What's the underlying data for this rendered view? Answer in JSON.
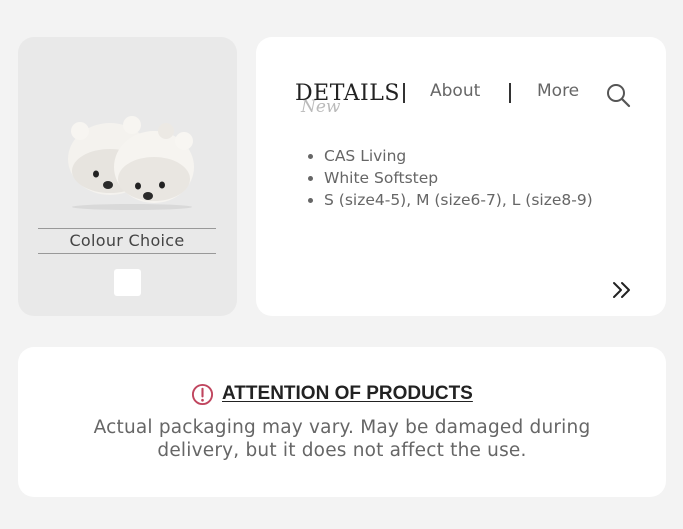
{
  "product": {
    "image_icon": "plush-slippers-image",
    "colour_label": "Colour Choice",
    "swatch_color": "#ffffff"
  },
  "details": {
    "tabs": {
      "details": "DETAILS",
      "details_overlay": "New",
      "about": "About",
      "more": "More"
    },
    "search_icon": "search-icon",
    "specs": [
      "CAS Living",
      "White Softstep",
      "S (size4-5), M (size6-7), L (size8-9)"
    ],
    "next_icon": "double-chevron-right-icon"
  },
  "attention": {
    "icon": "alert-circle-icon",
    "icon_color": "#c0455e",
    "heading": "ATTENTION OF PRODUCTS",
    "body": "Actual packaging may vary. May be damaged during delivery, but it does not affect the use."
  }
}
